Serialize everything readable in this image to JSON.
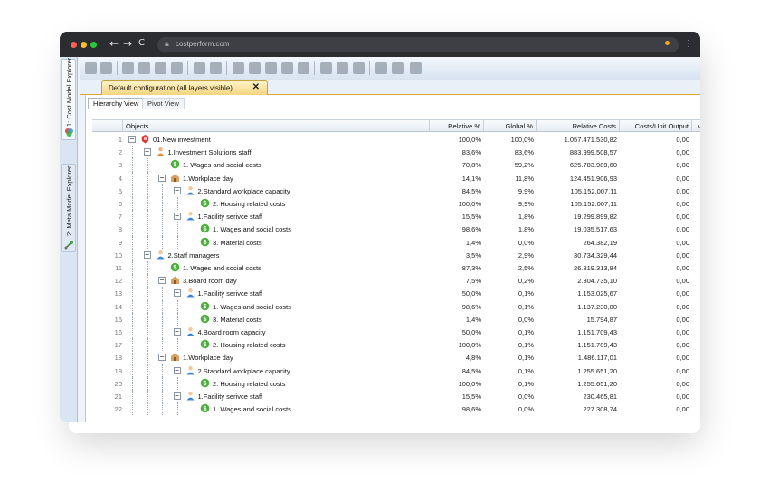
{
  "browser": {
    "address": "costperform.com",
    "nav_back": "←",
    "nav_forward": "→",
    "nav_reload": "C",
    "menu": "⋮"
  },
  "sidebar": {
    "tabs": [
      {
        "label": "1: Cost Model Explorer"
      },
      {
        "label": "2: Meta Model Explorer"
      }
    ]
  },
  "document_tab": {
    "label": "Default configuration (all layers visible)",
    "close": "✕"
  },
  "view_tabs": [
    {
      "label": "Hierarchy View",
      "active": true
    },
    {
      "label": "Pivot View",
      "active": false
    }
  ],
  "table": {
    "columns": [
      "Objects",
      "Relative %",
      "Global %",
      "Relative Costs",
      "Costs/Unit Output",
      "Vo"
    ],
    "rows": [
      {
        "n": "1",
        "level": 0,
        "exp": "−",
        "icon": "investment-icon",
        "label": "01.New investment",
        "rel": "100,0%",
        "glob": "100,0%",
        "costs": "1.057.471.530,82",
        "unit": "0,00"
      },
      {
        "n": "2",
        "level": 1,
        "exp": "−",
        "icon": "staff-icon",
        "label": "1.Investment Solutions staff",
        "rel": "83,6%",
        "glob": "83,6%",
        "costs": "883.999.508,57",
        "unit": "0,00"
      },
      {
        "n": "3",
        "level": 2,
        "exp": "",
        "icon": "cost-icon",
        "label": "1. Wages and social costs",
        "rel": "70,8%",
        "glob": "59,2%",
        "costs": "625.783.989,60",
        "unit": "0,00"
      },
      {
        "n": "4",
        "level": 2,
        "exp": "−",
        "icon": "workplace-icon",
        "label": "1.Workplace day",
        "rel": "14,1%",
        "glob": "11,8%",
        "costs": "124.451.906,93",
        "unit": "0,00"
      },
      {
        "n": "5",
        "level": 3,
        "exp": "−",
        "icon": "person-icon",
        "label": "2.Standard workplace capacity",
        "rel": "84,5%",
        "glob": "9,9%",
        "costs": "105.152.007,11",
        "unit": "0,00"
      },
      {
        "n": "6",
        "level": 4,
        "exp": "",
        "icon": "cost-icon",
        "label": "2. Housing related costs",
        "rel": "100,0%",
        "glob": "9,9%",
        "costs": "105.152.007,11",
        "unit": "0,00"
      },
      {
        "n": "7",
        "level": 3,
        "exp": "−",
        "icon": "person-icon",
        "label": "1.Facility serivce staff",
        "rel": "15,5%",
        "glob": "1,8%",
        "costs": "19.299.899,82",
        "unit": "0,00"
      },
      {
        "n": "8",
        "level": 4,
        "exp": "",
        "icon": "cost-icon",
        "label": "1. Wages and social costs",
        "rel": "98,6%",
        "glob": "1,8%",
        "costs": "19.035.517,63",
        "unit": "0,00"
      },
      {
        "n": "9",
        "level": 4,
        "exp": "",
        "icon": "cost-icon",
        "label": "3. Material costs",
        "rel": "1,4%",
        "glob": "0,0%",
        "costs": "264.382,19",
        "unit": "0,00"
      },
      {
        "n": "10",
        "level": 1,
        "exp": "−",
        "icon": "person-icon",
        "label": "2.Staff managers",
        "rel": "3,5%",
        "glob": "2,9%",
        "costs": "30.734.329,44",
        "unit": "0,00"
      },
      {
        "n": "11",
        "level": 2,
        "exp": "",
        "icon": "cost-icon",
        "label": "1. Wages and social costs",
        "rel": "87,3%",
        "glob": "2,5%",
        "costs": "26.819.313,84",
        "unit": "0,00"
      },
      {
        "n": "12",
        "level": 2,
        "exp": "−",
        "icon": "workplace-icon",
        "label": "3.Board room day",
        "rel": "7,5%",
        "glob": "0,2%",
        "costs": "2.304.735,10",
        "unit": "0,00"
      },
      {
        "n": "13",
        "level": 3,
        "exp": "−",
        "icon": "person-icon",
        "label": "1.Facility serivce staff",
        "rel": "50,0%",
        "glob": "0,1%",
        "costs": "1.153.025,67",
        "unit": "0,00"
      },
      {
        "n": "14",
        "level": 4,
        "exp": "",
        "icon": "cost-icon",
        "label": "1. Wages and social costs",
        "rel": "98,6%",
        "glob": "0,1%",
        "costs": "1.137.230,80",
        "unit": "0,00"
      },
      {
        "n": "15",
        "level": 4,
        "exp": "",
        "icon": "cost-icon",
        "label": "3. Material costs",
        "rel": "1,4%",
        "glob": "0,0%",
        "costs": "15.794,87",
        "unit": "0,00"
      },
      {
        "n": "16",
        "level": 3,
        "exp": "−",
        "icon": "person-icon",
        "label": "4.Board room capacity",
        "rel": "50,0%",
        "glob": "0,1%",
        "costs": "1.151.709,43",
        "unit": "0,00"
      },
      {
        "n": "17",
        "level": 4,
        "exp": "",
        "icon": "cost-icon",
        "label": "2. Housing related costs",
        "rel": "100,0%",
        "glob": "0,1%",
        "costs": "1.151.709,43",
        "unit": "0,00"
      },
      {
        "n": "18",
        "level": 2,
        "exp": "−",
        "icon": "workplace-icon",
        "label": "1.Workplace day",
        "rel": "4,8%",
        "glob": "0,1%",
        "costs": "1.486.117,01",
        "unit": "0,00"
      },
      {
        "n": "19",
        "level": 3,
        "exp": "−",
        "icon": "person-icon",
        "label": "2.Standard workplace capacity",
        "rel": "84,5%",
        "glob": "0,1%",
        "costs": "1.255.651,20",
        "unit": "0,00"
      },
      {
        "n": "20",
        "level": 4,
        "exp": "",
        "icon": "cost-icon",
        "label": "2. Housing related costs",
        "rel": "100,0%",
        "glob": "0,1%",
        "costs": "1.255.651,20",
        "unit": "0,00"
      },
      {
        "n": "21",
        "level": 3,
        "exp": "−",
        "icon": "person-icon",
        "label": "1.Facility serivce staff",
        "rel": "15,5%",
        "glob": "0,0%",
        "costs": "230.465,81",
        "unit": "0,00"
      },
      {
        "n": "22",
        "level": 4,
        "exp": "",
        "icon": "cost-icon",
        "label": "1. Wages and social costs",
        "rel": "98,6%",
        "glob": "0,0%",
        "costs": "227.308,74",
        "unit": "0,00"
      }
    ]
  },
  "colors": {
    "chrome": "#2b2d31",
    "tab_active": "#f4d57f",
    "cost_icon": "#4caf3c",
    "investment_icon": "#d93a3a",
    "staff_icon": "#e8892b",
    "person_icon": "#3d86d6"
  }
}
